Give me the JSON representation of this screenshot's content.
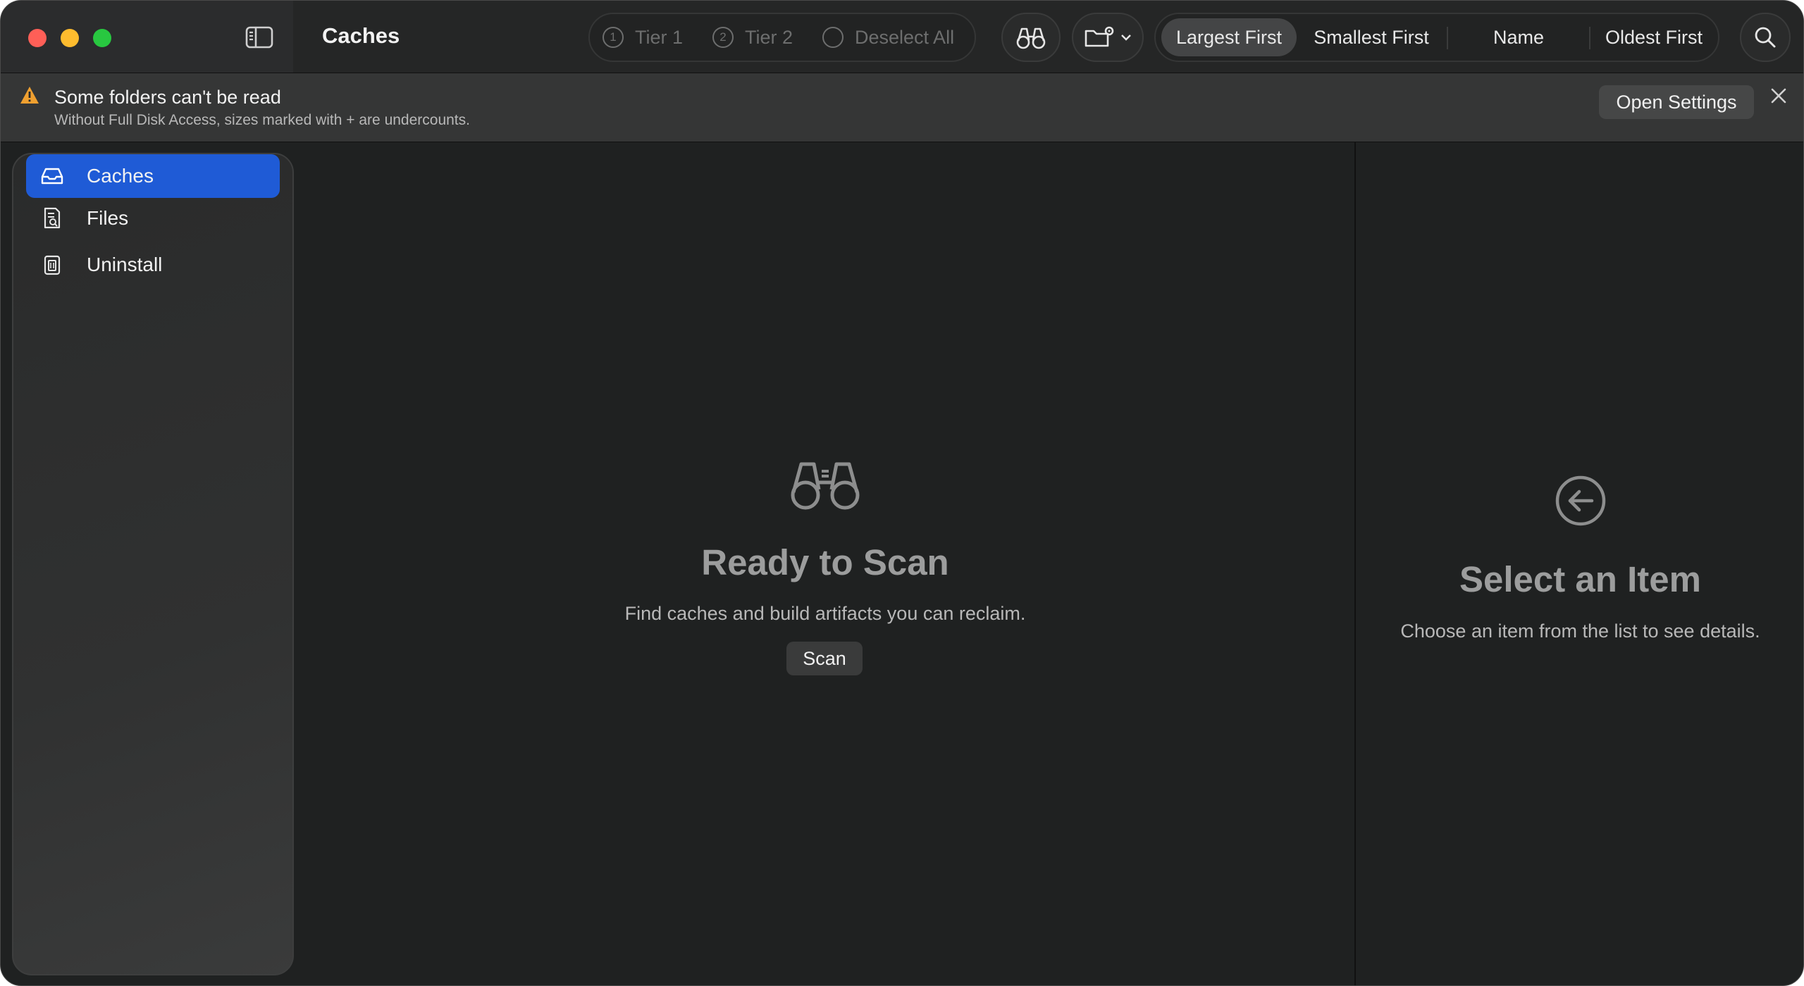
{
  "window": {
    "title": "Caches"
  },
  "toolbar": {
    "tier1": {
      "number": "1",
      "label": "Tier 1"
    },
    "tier2": {
      "number": "2",
      "label": "Tier 2"
    },
    "deselect_all": "Deselect All",
    "sort_options": [
      {
        "label": "Largest First",
        "selected": true
      },
      {
        "label": "Smallest First",
        "selected": false
      },
      {
        "label": "Name",
        "selected": false
      },
      {
        "label": "Oldest First",
        "selected": false
      }
    ],
    "icons": [
      "sidebar-toggle-icon",
      "binoculars-icon",
      "folder-gear-icon",
      "chevron-down-icon",
      "search-icon"
    ]
  },
  "banner": {
    "title": "Some folders can't be read",
    "subtitle": "Without Full Disk Access, sizes marked with + are undercounts.",
    "action": "Open Settings",
    "icons": [
      "warning-icon",
      "close-icon"
    ],
    "warning_color": "#f0a030"
  },
  "sidebar": {
    "items": [
      {
        "label": "Caches",
        "icon": "tray-icon",
        "selected": true
      },
      {
        "label": "Files",
        "icon": "document-search-icon",
        "selected": false
      },
      {
        "label": "Uninstall",
        "icon": "trash-icon",
        "selected": false
      }
    ],
    "selection_color": "#1f5bd6"
  },
  "main": {
    "title": "Ready to Scan",
    "subtitle": "Find caches and build artifacts you can reclaim.",
    "scan_button": "Scan",
    "icon": "binoculars-icon"
  },
  "detail": {
    "title": "Select an Item",
    "subtitle": "Choose an item from the list to see details.",
    "icon": "arrow-left-circle-icon"
  }
}
